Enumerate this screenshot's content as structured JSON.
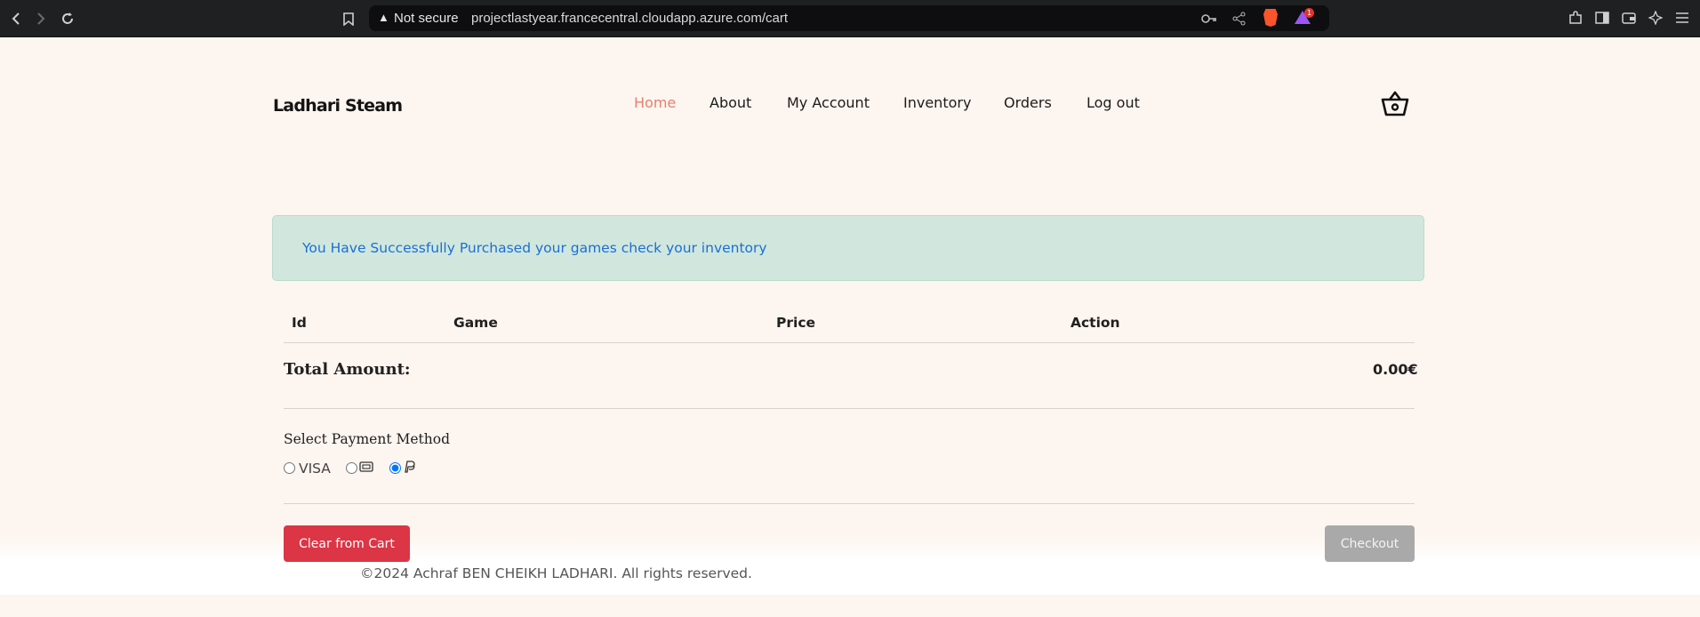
{
  "browser": {
    "security_label": "Not secure",
    "url": "projectlastyear.francecentral.cloudapp.azure.com/cart",
    "rewards_badge": "1",
    "icons": [
      "back-icon",
      "forward-icon",
      "reload-icon",
      "bookmark-icon",
      "key-icon",
      "share-icon",
      "brave-shield-icon",
      "brave-rewards-icon",
      "extensions-icon",
      "sidebar-icon",
      "wallet-icon",
      "leo-ai-icon",
      "menu-icon"
    ]
  },
  "site": {
    "logo": "Ladhari Steam",
    "nav": [
      "Home",
      "About",
      "My Account",
      "Inventory",
      "Orders",
      "Log out"
    ],
    "active_nav": "Home",
    "accent_color": "#e8806e"
  },
  "alert": {
    "message": "You Have Successfully Purchased your games check your inventory"
  },
  "cart": {
    "columns": [
      "Id",
      "Game",
      "Price",
      "Action"
    ],
    "rows": [],
    "total_label": "Total Amount:",
    "total_value": "0.00€"
  },
  "payment": {
    "title": "Select Payment Method",
    "options": [
      "VISA",
      "card-icon",
      "paypal-icon"
    ],
    "selected": "paypal-icon"
  },
  "buttons": {
    "clear": "Clear from Cart",
    "checkout": "Checkout"
  },
  "footer": {
    "text": "©2024 Achraf BEN CHEIKH LADHARI. All rights reserved."
  }
}
